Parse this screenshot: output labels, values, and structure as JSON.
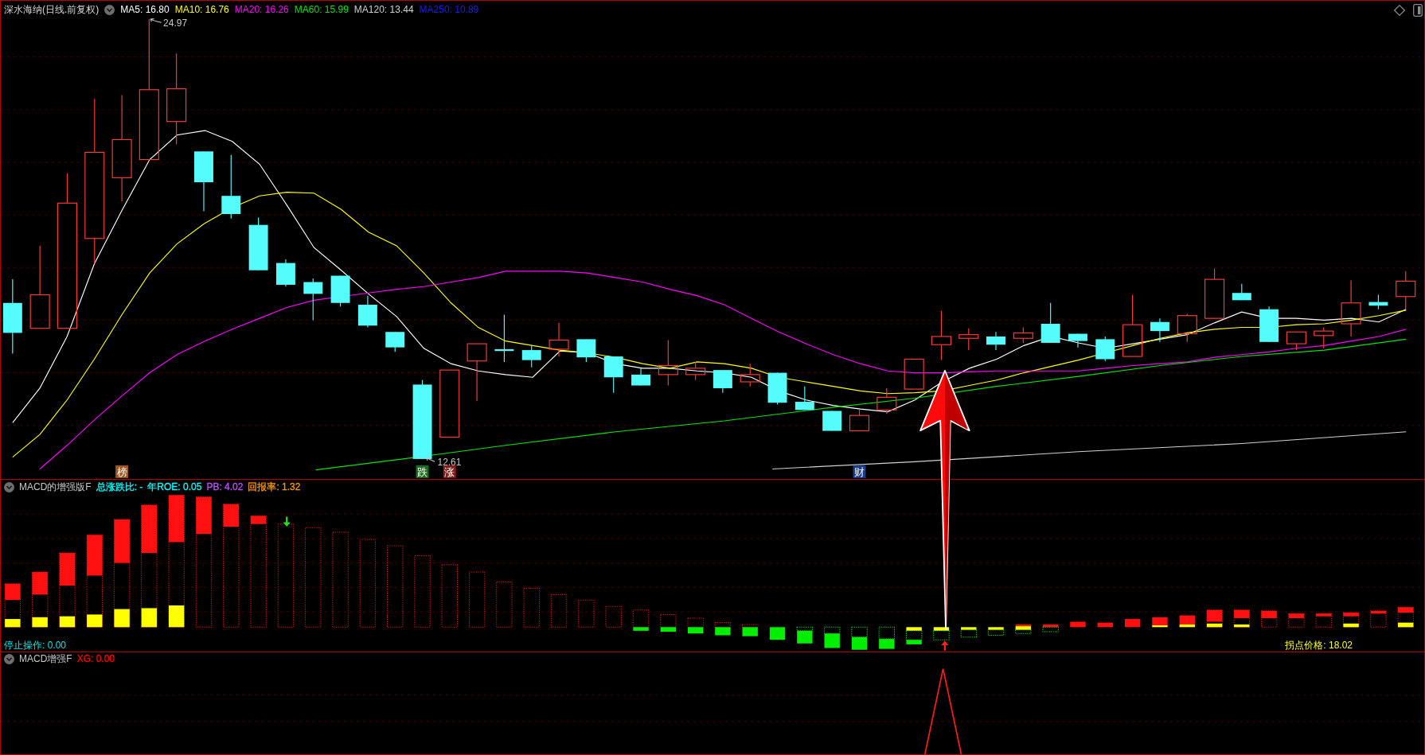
{
  "main_chart": {
    "title": "深水海纳(日线.前复权)",
    "moving_averages": [
      {
        "label": "MA5: 16.80",
        "color": "#ffffff"
      },
      {
        "label": "MA10: 16.76",
        "color": "#ffff00"
      },
      {
        "label": "MA20: 16.26",
        "color": "#ff00ff"
      },
      {
        "label": "MA60: 15.99",
        "color": "#00e600"
      },
      {
        "label": "MA120: 13.44",
        "color": "#d0d0d0"
      },
      {
        "label": "MA250: 10.89",
        "color": "#1a1aff"
      }
    ],
    "high_label": "24.97",
    "low_label": "12.61",
    "event_tags": [
      {
        "text": "榜",
        "color": "#a0561c"
      },
      {
        "text": "跌",
        "color": "#1c6e1c"
      },
      {
        "text": "涨",
        "color": "#861c1c"
      },
      {
        "text": "财",
        "color": "#1c3a8a"
      }
    ]
  },
  "macd_panel": {
    "title": "MACD的增强版F",
    "indicators": [
      {
        "label": "总涨跌比: -",
        "color": "#00ffff"
      },
      {
        "label": "年ROE: 0.05",
        "color": "#00ffff"
      },
      {
        "label": "PB: 4.02",
        "color": "#c050ff"
      },
      {
        "label": "回报率: 1.32",
        "color": "#ff9900"
      }
    ],
    "stop_label": "停止操作: 0.00",
    "turn_price_label": "拐点价格: 18.02"
  },
  "signal_panel": {
    "title": "MACD增强F",
    "indicators": [
      {
        "label": "XG: 0.00",
        "color": "#ff0000"
      }
    ]
  }
}
